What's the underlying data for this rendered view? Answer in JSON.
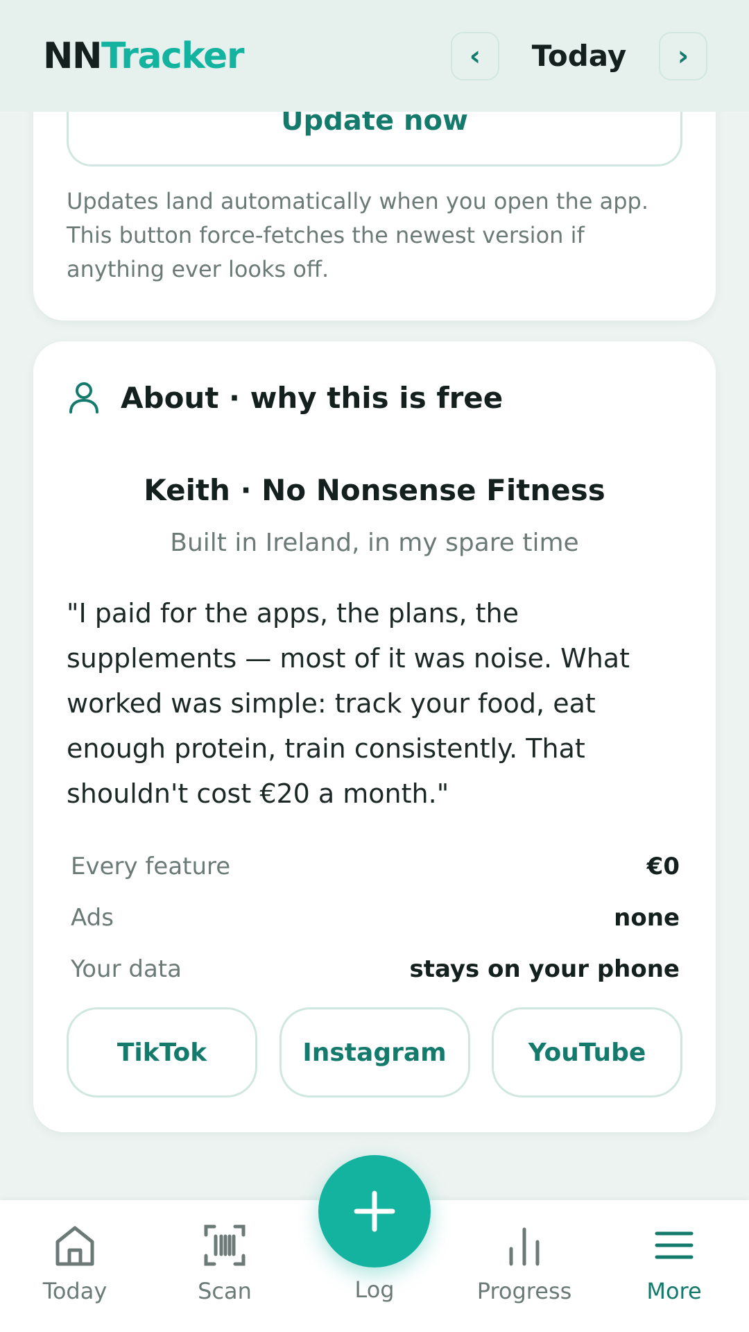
{
  "header": {
    "brand_part1": "NN",
    "brand_part2": "Tracker",
    "prev_label": "‹",
    "date_label": "Today",
    "next_label": "›"
  },
  "update_card": {
    "button_label": "Update now",
    "note": "Updates land automatically when you open the app. This button force-fetches the newest version if anything ever looks off."
  },
  "about_card": {
    "title": "About · why this is free",
    "icon": "person-icon",
    "author": "Keith · No Nonsense Fitness",
    "author_sub": "Built in Ireland, in my spare time",
    "quote": "\"I paid for the apps, the plans, the supplements — most of it was noise. What worked was simple: track your food, eat enough protein, train consistently. That shouldn't cost €20 a month.\"",
    "facts": [
      {
        "key": "Every feature",
        "value": "€0"
      },
      {
        "key": "Ads",
        "value": "none"
      },
      {
        "key": "Your data",
        "value": "stays on your phone"
      }
    ],
    "socials": [
      {
        "label": "TikTok"
      },
      {
        "label": "Instagram"
      },
      {
        "label": "YouTube"
      }
    ]
  },
  "bottom_nav": {
    "items": [
      {
        "label": "Today",
        "icon": "home-icon"
      },
      {
        "label": "Scan",
        "icon": "barcode-scan-icon"
      },
      {
        "label": "Log",
        "icon": "plus-icon"
      },
      {
        "label": "Progress",
        "icon": "bar-chart-icon"
      },
      {
        "label": "More",
        "icon": "menu-icon",
        "active": true
      }
    ]
  },
  "colors": {
    "accent": "#14b3a0",
    "accent_dark": "#137a6c",
    "text": "#13201d",
    "muted": "#6b7a77",
    "background": "#edf3f1"
  }
}
